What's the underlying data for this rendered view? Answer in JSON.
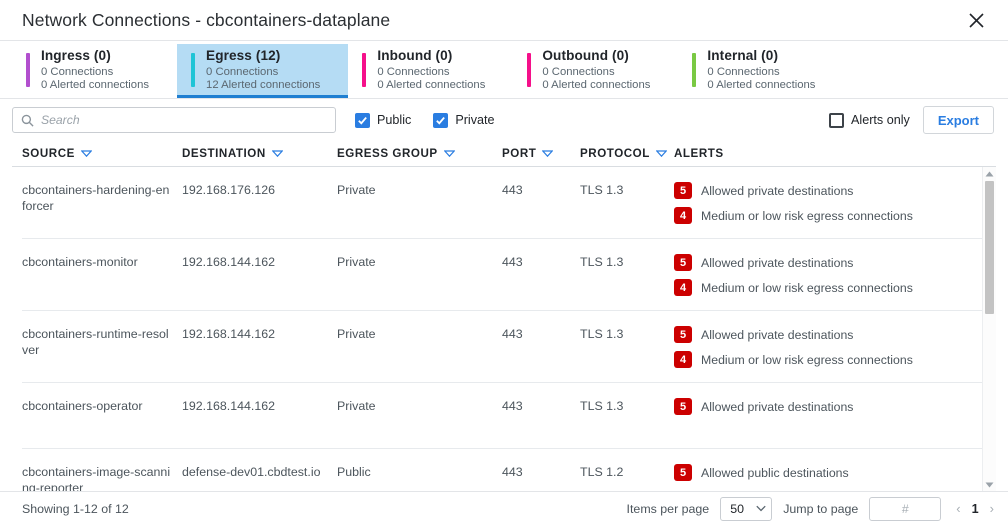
{
  "window": {
    "title": "Network Connections - cbcontainers-dataplane",
    "close_icon": "close-icon"
  },
  "tabs": [
    {
      "label": "Ingress (0)",
      "connections": "0 Connections",
      "alerted": "0 Alerted connections",
      "color": "#b24fce",
      "selected": false
    },
    {
      "label": "Egress (12)",
      "connections": "0 Connections",
      "alerted": "12 Alerted connections",
      "color": "#1fc4d6",
      "selected": true
    },
    {
      "label": "Inbound (0)",
      "connections": "0 Connections",
      "alerted": "0 Alerted connections",
      "color": "#f5108a",
      "selected": false
    },
    {
      "label": "Outbound (0)",
      "connections": "0 Connections",
      "alerted": "0 Alerted connections",
      "color": "#f5108a",
      "selected": false
    },
    {
      "label": "Internal (0)",
      "connections": "0 Connections",
      "alerted": "0 Alerted connections",
      "color": "#7ac943",
      "selected": false
    }
  ],
  "toolbar": {
    "search_placeholder": "Search",
    "search_value": "",
    "search_icon": "search-icon",
    "public_label": "Public",
    "public_checked": true,
    "private_label": "Private",
    "private_checked": true,
    "alerts_only_label": "Alerts only",
    "alerts_only_checked": false,
    "export_label": "Export"
  },
  "table": {
    "columns": [
      {
        "label": "SOURCE",
        "sortable": true
      },
      {
        "label": "DESTINATION",
        "sortable": true
      },
      {
        "label": "EGRESS GROUP",
        "sortable": true
      },
      {
        "label": "PORT",
        "sortable": true
      },
      {
        "label": "PROTOCOL",
        "sortable": true
      },
      {
        "label": "ALERTS",
        "sortable": false
      }
    ],
    "rows": [
      {
        "source": "cbcontainers-hardening-enforcer",
        "destination": "192.168.176.126",
        "egress_group": "Private",
        "port": "443",
        "protocol": "TLS 1.3",
        "alerts": [
          {
            "count": "5",
            "text": "Allowed private destinations"
          },
          {
            "count": "4",
            "text": "Medium or low risk egress connections"
          }
        ]
      },
      {
        "source": "cbcontainers-monitor",
        "destination": "192.168.144.162",
        "egress_group": "Private",
        "port": "443",
        "protocol": "TLS 1.3",
        "alerts": [
          {
            "count": "5",
            "text": "Allowed private destinations"
          },
          {
            "count": "4",
            "text": "Medium or low risk egress connections"
          }
        ]
      },
      {
        "source": "cbcontainers-runtime-resolver",
        "destination": "192.168.144.162",
        "egress_group": "Private",
        "port": "443",
        "protocol": "TLS 1.3",
        "alerts": [
          {
            "count": "5",
            "text": "Allowed private destinations"
          },
          {
            "count": "4",
            "text": "Medium or low risk egress connections"
          }
        ]
      },
      {
        "source": "cbcontainers-operator",
        "destination": "192.168.144.162",
        "egress_group": "Private",
        "port": "443",
        "protocol": "TLS 1.3",
        "alerts": [
          {
            "count": "5",
            "text": "Allowed private destinations"
          }
        ]
      },
      {
        "source": "cbcontainers-image-scanning-reporter",
        "destination": "defense-dev01.cbdtest.io",
        "egress_group": "Public",
        "port": "443",
        "protocol": "TLS 1.2",
        "alerts": [
          {
            "count": "5",
            "text": "Allowed public destinations"
          }
        ]
      }
    ]
  },
  "footer": {
    "showing": "Showing 1-12 of 12",
    "items_per_page_label": "Items per page",
    "items_per_page_value": "50",
    "jump_to_page_label": "Jump to page",
    "jump_to_page_placeholder": "#",
    "jump_to_page_value": "",
    "prev_icon": "chevron-left-icon",
    "next_icon": "chevron-right-icon",
    "current_page": "1"
  },
  "colors": {
    "accent_blue": "#2a7de1",
    "badge_red": "#cc0000",
    "selected_tab_bg": "#b5dcf4"
  }
}
